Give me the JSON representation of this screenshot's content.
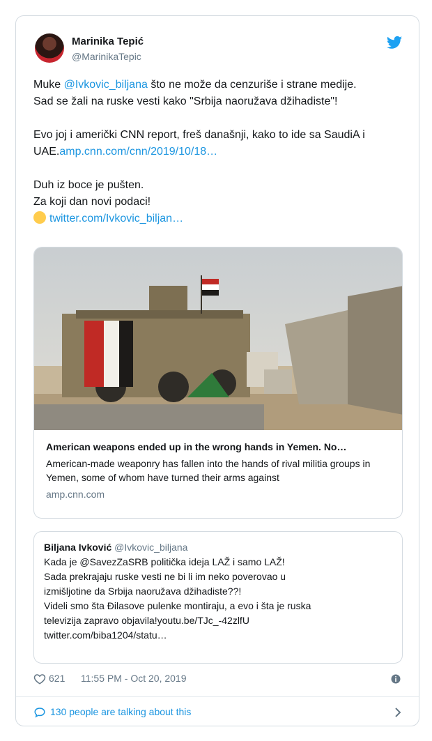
{
  "tweet": {
    "author_name": "Marinika Tepić",
    "author_handle": "@MarinikaTepic",
    "lines": {
      "l1_pre": "Muke ",
      "l1_mention": "@Ivkovic_biljana",
      "l1_post": " što ne može da cenzuriše i strane medije.",
      "l2": "Sad se žali na ruske vesti kako \"Srbija naoružava džihadiste\"!",
      "l3": "Evo joj i američki CNN report, freš današnji, kako to ide sa SaudiA i",
      "l4_pre": "UAE.",
      "l4_link": "amp.cnn.com/cnn/2019/10/18…",
      "l5": "Duh iz boce je pušten.",
      "l6": "Za koji dan novi podaci!",
      "l7_link": "twitter.com/Ivkovic_biljan…"
    },
    "media_card": {
      "title": "American weapons ended up in the wrong hands in Yemen. No…",
      "description": "American-made weaponry has fallen into the hands of rival militia groups in Yemen, some of whom have turned their arms against",
      "domain": "amp.cnn.com"
    },
    "quote": {
      "author_name": "Biljana Ivković",
      "author_handle": "@Ivkovic_biljana",
      "line1": "Kada je @SavezZaSRB politička ideja LAŽ i samo LAŽ!",
      "line2": "Sada prekrajaju ruske vesti  ne bi li im neko poverovao u",
      "line3": "izmišljotine da Srbija naoružava džihadiste??!",
      "line4": "Videli smo šta Đilasove pulenke montiraju, a evo i šta je ruska",
      "line5": "televizija zapravo objavila!youtu.be/TJc_-42zlfU",
      "line6": "twitter.com/biba1204/statu…"
    },
    "likes": "621",
    "timestamp": "11:55 PM - Oct 20, 2019",
    "talking": "130 people are talking about this"
  },
  "colors": {
    "link": "#1b95e0",
    "muted": "#657786",
    "border": "#d4dbe1"
  },
  "icons": [
    "twitter-bird-icon",
    "heart-icon",
    "info-icon",
    "comment-bubble-icon",
    "chevron-right-icon",
    "fist-emoji-icon"
  ]
}
